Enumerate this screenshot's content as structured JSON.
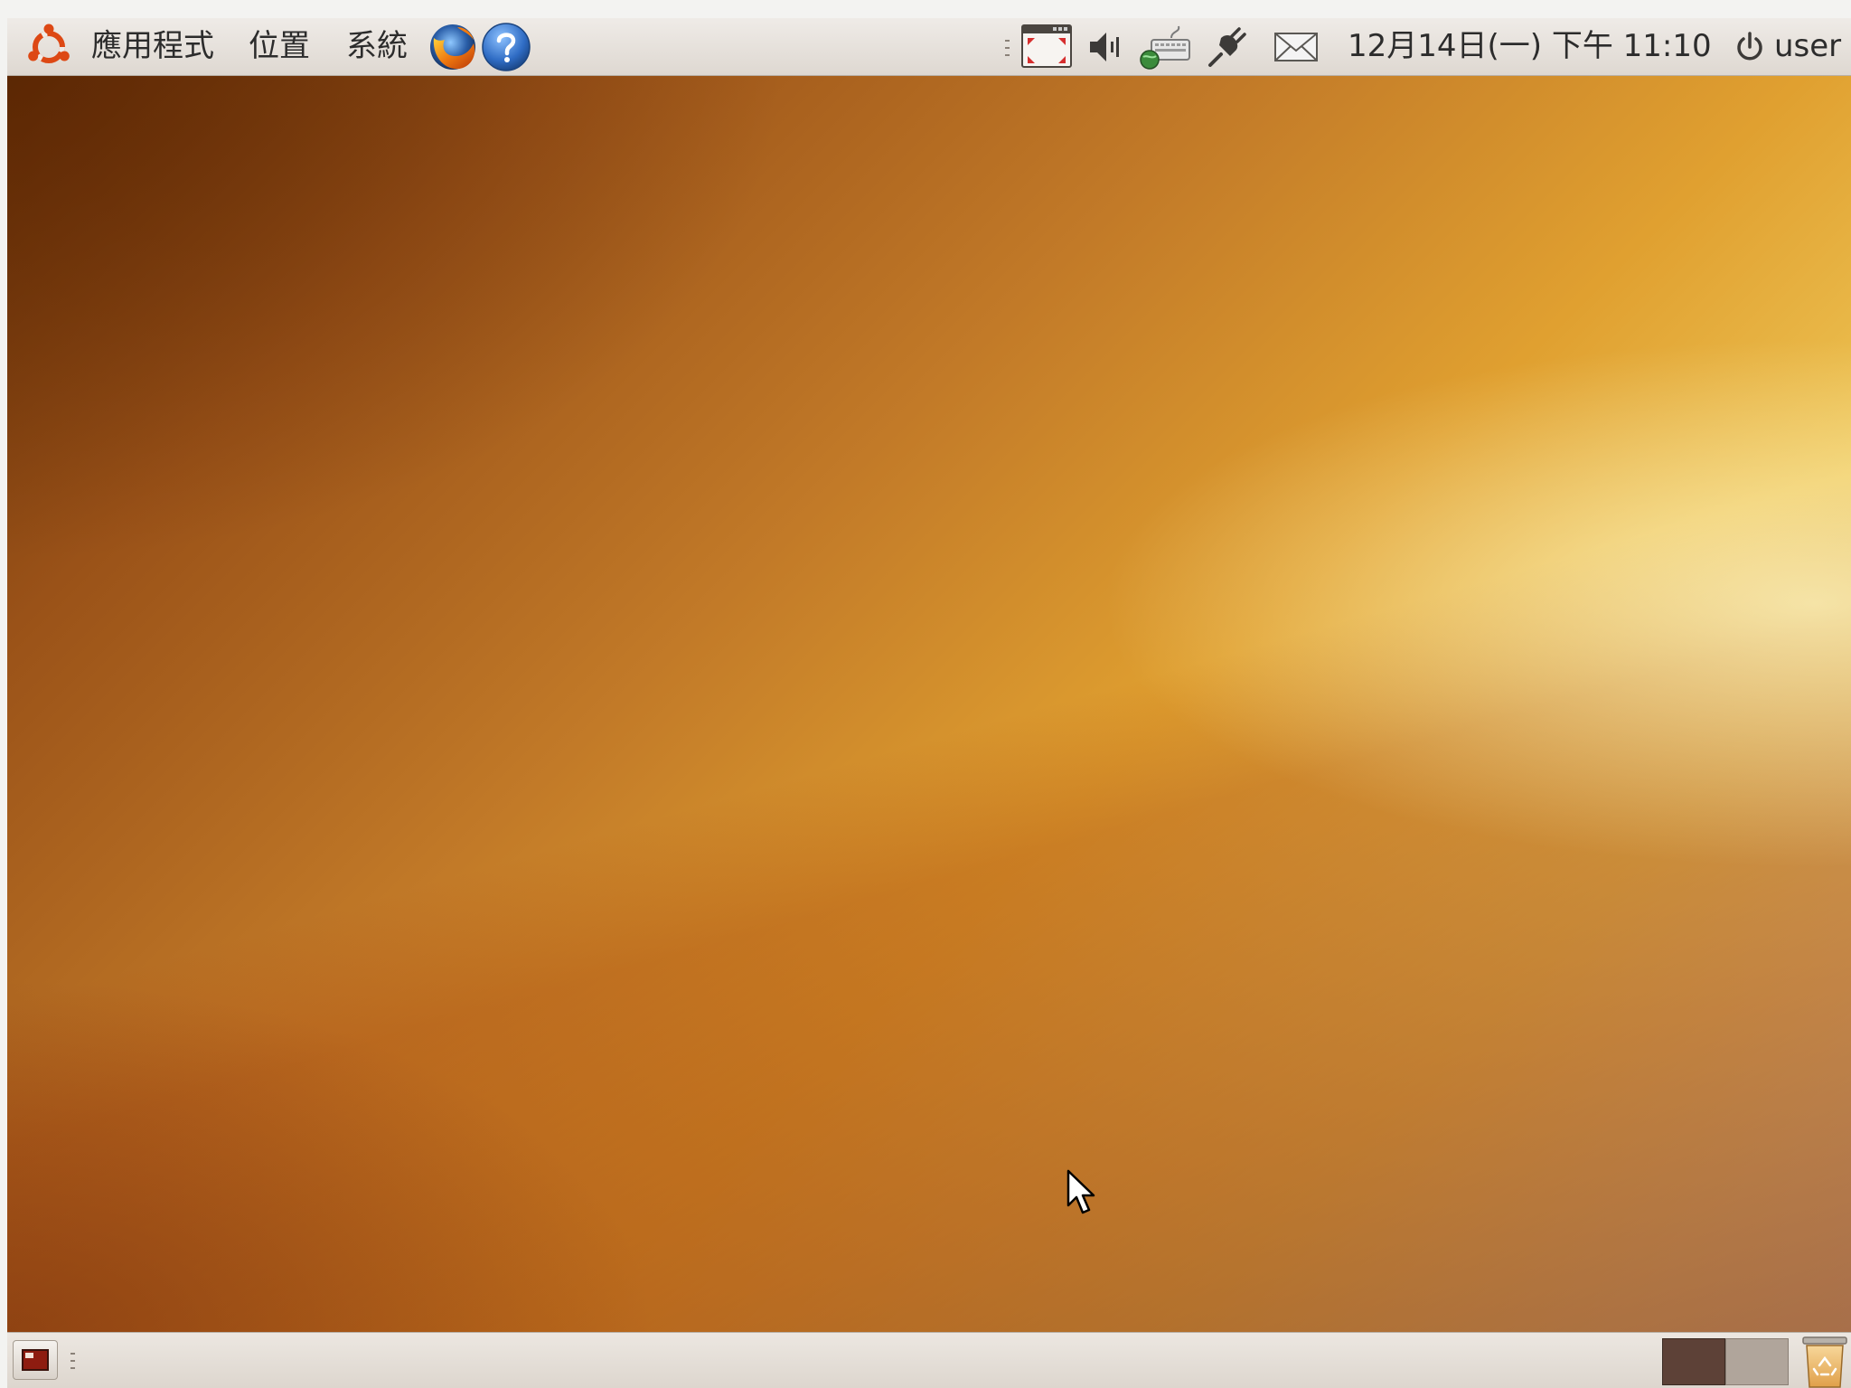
{
  "top_panel": {
    "menus": [
      "應用程式",
      "位置",
      "系統"
    ],
    "clock": "12月14日(一) 下午 11:10",
    "user": "user",
    "icons": [
      "ubuntu-logo-icon",
      "firefox-icon",
      "help-icon",
      "show-windows-icon",
      "volume-icon",
      "network-icon",
      "power-plug-icon",
      "mail-icon",
      "power-icon"
    ]
  },
  "bottom_panel": {
    "icons": [
      "show-desktop-icon",
      "trash-icon"
    ],
    "workspaces": 2,
    "active_workspace": 1
  },
  "colors": {
    "panel": "#e6e1db",
    "wallpaper_dark": "#6a3208",
    "wallpaper_mid": "#d08a28",
    "wallpaper_light": "#fff3c0",
    "ubuntu_orange": "#dd4814"
  }
}
